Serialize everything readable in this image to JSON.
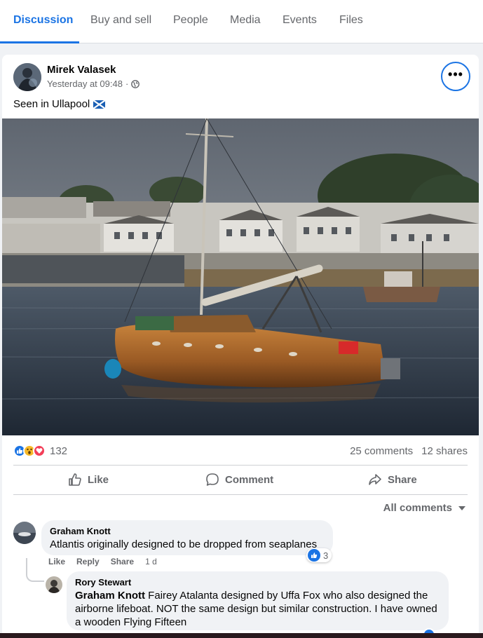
{
  "tabs": [
    {
      "label": "Discussion"
    },
    {
      "label": "Buy and sell"
    },
    {
      "label": "People"
    },
    {
      "label": "Media"
    },
    {
      "label": "Events"
    },
    {
      "label": "Files"
    }
  ],
  "post": {
    "author": "Mirek Valasek",
    "timestamp": "Yesterday at 09:48",
    "separator": "·",
    "text": "Seen in Ullapool",
    "more_label": "•••",
    "reaction_count": "132",
    "comments_count": "25 comments",
    "shares_count": "12 shares"
  },
  "actions": {
    "like": "Like",
    "comment": "Comment",
    "share": "Share"
  },
  "sort_label": "All comments",
  "comments": [
    {
      "author": "Graham Knott",
      "text": "Atlantis originally designed to be dropped from seaplanes",
      "like": "Like",
      "reply": "Reply",
      "share": "Share",
      "time": "1 d",
      "reactions": "3"
    },
    {
      "author": "Rory Stewart",
      "mention": "Graham Knott",
      "text": " Fairey Atalanta designed by Uffa Fox who also designed the airborne lifeboat. NOT the same design but similar construction. I have owned a wooden Flying Fifteen"
    }
  ],
  "colors": {
    "accent": "#1b74e4",
    "secondary_text": "#65676b",
    "bubble": "#f0f2f5",
    "love": "#f33e58",
    "haha": "#f7b928"
  }
}
